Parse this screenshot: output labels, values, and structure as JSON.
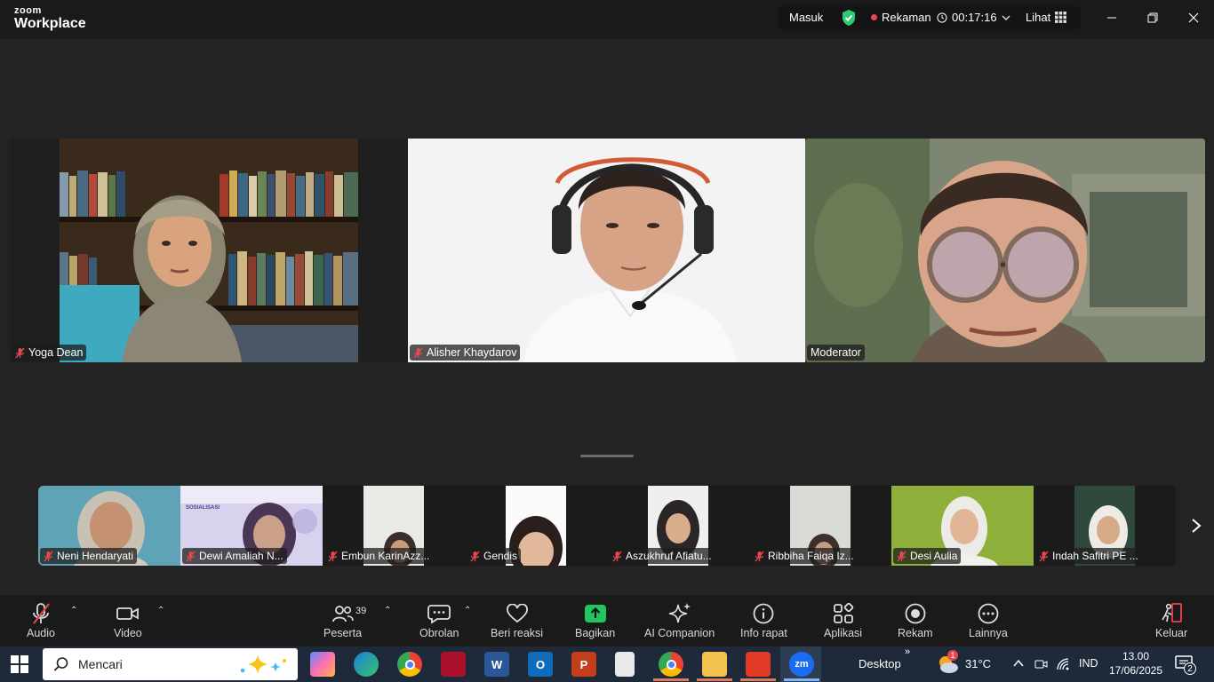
{
  "app": {
    "brand_top": "zoom",
    "brand_bottom": "Workplace"
  },
  "status": {
    "signin": "Masuk",
    "recording": "Rekaman",
    "timer": "00:17:16",
    "view": "Lihat"
  },
  "main_tiles": [
    {
      "name": "Yoga Dean"
    },
    {
      "name": "Alisher Khaydarov"
    },
    {
      "name": "Moderator"
    }
  ],
  "strip_tiles": [
    {
      "name": "Neni Hendaryati"
    },
    {
      "name": "Dewi Amaliah N..."
    },
    {
      "name": "Embun KarinAzz..."
    },
    {
      "name": "Gendis"
    },
    {
      "name": "Aszukhruf Afiatu..."
    },
    {
      "name": "Ribbiha Faiqa Iz..."
    },
    {
      "name": "Desi Aulia"
    },
    {
      "name": "Indah Safitri PE ..."
    }
  ],
  "strip_slide": {
    "title": "SOSIALISASI"
  },
  "toolbar": {
    "audio": "Audio",
    "video": "Video",
    "participants": "Peserta",
    "participants_count": "39",
    "chat": "Obrolan",
    "react": "Beri reaksi",
    "share": "Bagikan",
    "ai": "AI Companion",
    "info": "Info rapat",
    "apps": "Aplikasi",
    "record": "Rekam",
    "more": "Lainnya",
    "leave": "Keluar"
  },
  "taskbar": {
    "search_placeholder": "Mencari",
    "desktop": "Desktop",
    "weather": "31°C",
    "weather_badge": "1",
    "lang": "IND",
    "time": "13.00",
    "date": "17/06/2025",
    "notif_count": "2",
    "apps": [
      "Copilot",
      "Edge",
      "Chrome",
      "Mendeley",
      "Word",
      "Outlook",
      "PowerPoint",
      "File",
      "Chrome",
      "File Explorer",
      "Acrobat",
      "Zoom"
    ]
  },
  "colors": {
    "speaker_border": "#2ed573",
    "share_green": "#22c55e",
    "recording_dot": "#e5484d",
    "leave_red": "#e5484d"
  }
}
